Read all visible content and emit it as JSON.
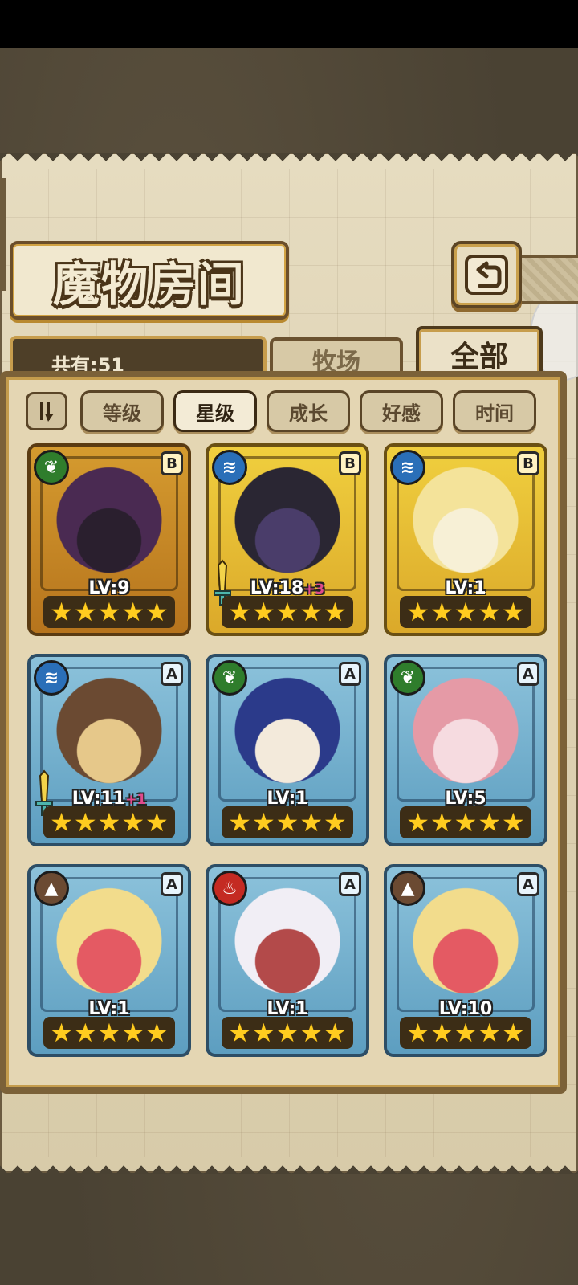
{
  "header": {
    "title": "魔物房间"
  },
  "tabs": {
    "count_label": "共有:51",
    "farm": "牧场",
    "all": "全部"
  },
  "sort": {
    "toggle_icon": "sort-order-icon",
    "options": [
      "等级",
      "星级",
      "成长",
      "好感",
      "时间"
    ],
    "active": "星级"
  },
  "monsters": [
    {
      "element": "nature",
      "element_color": "#2f7d2c",
      "rank": "B",
      "frame": "gold-dark",
      "level": "LV:9",
      "bonus": "",
      "stars": 5,
      "has_equipment": false,
      "portrait_colors": [
        "#4a2a52",
        "#2a1f2e"
      ]
    },
    {
      "element": "water",
      "element_color": "#2a6fb8",
      "rank": "B",
      "frame": "gold",
      "level": "LV:18",
      "bonus": "+3",
      "stars": 5,
      "has_equipment": true,
      "portrait_colors": [
        "#2a2633",
        "#4a3d6a"
      ]
    },
    {
      "element": "water",
      "element_color": "#2a6fb8",
      "rank": "B",
      "frame": "gold",
      "level": "LV:1",
      "bonus": "",
      "stars": 5,
      "has_equipment": false,
      "portrait_colors": [
        "#f4e39a",
        "#f7f0d6"
      ]
    },
    {
      "element": "water",
      "element_color": "#2a6fb8",
      "rank": "A",
      "frame": "blue",
      "level": "LV:11",
      "bonus": "+1",
      "stars": 5,
      "has_equipment": true,
      "portrait_colors": [
        "#6b4a32",
        "#e6c88a"
      ]
    },
    {
      "element": "nature",
      "element_color": "#2f7d2c",
      "rank": "A",
      "frame": "blue",
      "level": "LV:1",
      "bonus": "",
      "stars": 5,
      "has_equipment": false,
      "portrait_colors": [
        "#2b3a8a",
        "#f3eadb"
      ]
    },
    {
      "element": "nature",
      "element_color": "#2f7d2c",
      "rank": "A",
      "frame": "blue",
      "level": "LV:5",
      "bonus": "",
      "stars": 5,
      "has_equipment": false,
      "portrait_colors": [
        "#e59aa6",
        "#f6dbe0"
      ]
    },
    {
      "element": "earth",
      "element_color": "#6b4a32",
      "rank": "A",
      "frame": "blue",
      "level": "LV:1",
      "bonus": "",
      "stars": 5,
      "has_equipment": false,
      "portrait_colors": [
        "#f2dc8c",
        "#e45a63"
      ]
    },
    {
      "element": "fire",
      "element_color": "#c42a22",
      "rank": "A",
      "frame": "blue",
      "level": "LV:1",
      "bonus": "",
      "stars": 5,
      "has_equipment": false,
      "portrait_colors": [
        "#f1eef5",
        "#b34a4a"
      ]
    },
    {
      "element": "earth",
      "element_color": "#6b4a32",
      "rank": "A",
      "frame": "blue",
      "level": "LV:10",
      "bonus": "",
      "stars": 5,
      "has_equipment": false,
      "portrait_colors": [
        "#f2dc8c",
        "#e45a63"
      ]
    }
  ],
  "icons": {
    "back": "back-arrow-icon",
    "nature": "leaf-icon",
    "water": "water-wave-icon",
    "earth": "mountain-icon",
    "fire": "flame-icon",
    "star": "star-icon",
    "equipment": "sword-icon"
  }
}
